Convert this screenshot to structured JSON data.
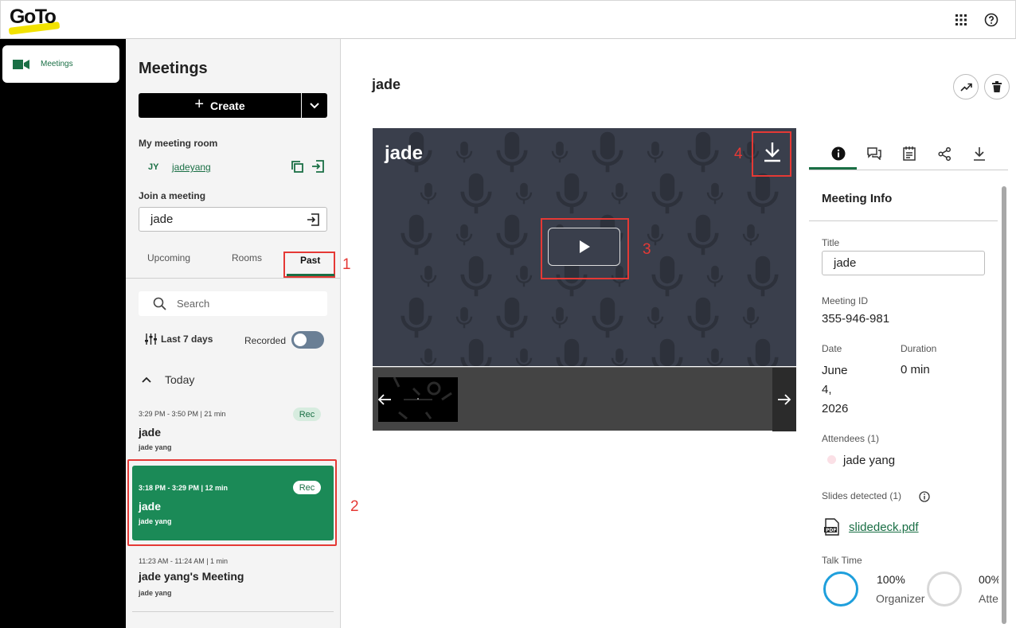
{
  "brand": {
    "logo_text": "GoTo",
    "accent": "#1b8a57",
    "logo_yellow": "#f2e200",
    "annotation_red": "#e53935"
  },
  "topbar": {
    "apps_icon": "grid-icon",
    "help_icon": "help-icon"
  },
  "rail": {
    "items": [
      {
        "label": "Meetings",
        "icon": "video-camera-icon"
      }
    ]
  },
  "panel": {
    "title": "Meetings",
    "create_label": "Create",
    "my_room_label": "My meeting room",
    "room_initials": "JY",
    "room_name": "jadeyang",
    "join_label": "Join a meeting",
    "join_value": "jade",
    "tabs": {
      "upcoming": "Upcoming",
      "rooms": "Rooms",
      "past": "Past"
    },
    "search_placeholder": "Search",
    "filter_label": "Last 7 days",
    "recorded_label": "Recorded",
    "recorded_on": true,
    "group_label": "Today",
    "meetings": [
      {
        "time": "3:29 PM  -  3:50 PM  |  21 min",
        "title": "jade",
        "host": "jade yang",
        "badge": "Rec"
      },
      {
        "time": "3:18 PM  -  3:29 PM  |  12 min",
        "title": "jade",
        "host": "jade yang",
        "badge": "Rec"
      },
      {
        "time": "11:23 AM  -  11:24 AM  |  1 min",
        "title": "jade yang's Meeting",
        "host": "jade yang"
      }
    ]
  },
  "main": {
    "title": "jade",
    "player_title": "jade"
  },
  "annotations": {
    "a1": "1",
    "a2": "2",
    "a3": "3",
    "a4": "4"
  },
  "info": {
    "section_title": "Meeting Info",
    "title_label": "Title",
    "title_value": "jade",
    "meeting_id_label": "Meeting ID",
    "meeting_id": "355-946-981",
    "date_label": "Date",
    "date_value": "June 4, 2026",
    "duration_label": "Duration",
    "duration_value": "0 min",
    "attendees_label": "Attendees (1)",
    "attendee": "jade yang",
    "slides_label": "Slides detected (1)",
    "slides_file": "slidedeck.pdf",
    "talk_label": "Talk Time",
    "talk_organizer_pct": "100%",
    "talk_organizer_label": "Organizer",
    "talk_other_pct": "00%",
    "talk_other_label": "Atte"
  }
}
